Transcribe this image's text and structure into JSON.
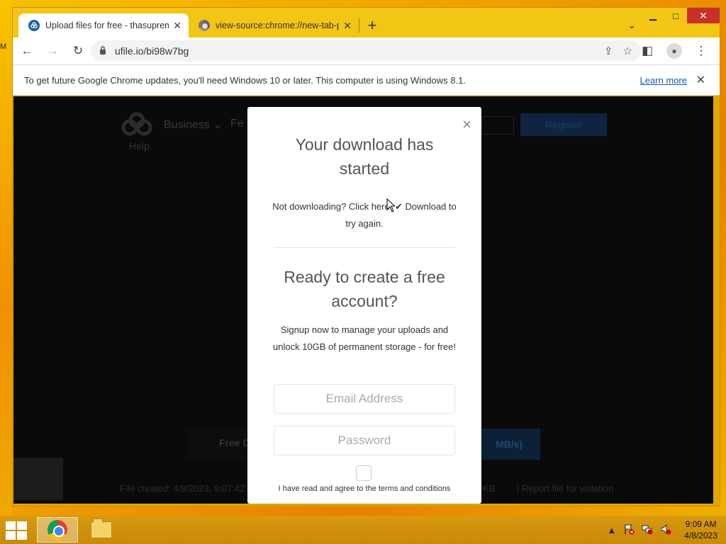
{
  "desktop": {
    "edge_label": "M"
  },
  "window": {
    "controls": {
      "minimize": "▁",
      "maximize": "□",
      "close": "✕"
    }
  },
  "tabs": [
    {
      "title": "Upload files for free - thasuprem",
      "favicon": "ufile-icon",
      "close": "✕",
      "active": true
    },
    {
      "title": "view-source:chrome://new-tab-p",
      "favicon": "chrome-icon",
      "close": "✕",
      "active": false
    }
  ],
  "new_tab": "+",
  "tab_search": "⌄",
  "toolbar": {
    "back": "←",
    "forward": "→",
    "reload": "↻",
    "url": "ufile.io/bi98w7bg",
    "share": "⇪",
    "star": "☆",
    "sidepanel": "◧",
    "profile": "●",
    "menu": "⋮"
  },
  "infobar": {
    "message": "To get future Google Chrome updates, you'll need Windows 10 or later. This computer is using Windows 8.1.",
    "learn_more": "Learn more",
    "close": "✕"
  },
  "background_page": {
    "help": "Help",
    "nav_business": "Business ⌄",
    "nav_fe": "Fe",
    "register": "Register",
    "free_left": "Free D",
    "free_right": "MB/s)",
    "file_created": "File created: 4/8/2023, 9:07:42",
    "file_size": "KB",
    "report": "|     Report file for violation"
  },
  "modal": {
    "close": "×",
    "heading_download": "Your download has started",
    "not_downloading": "Not downloading? Click here:",
    "download_link": "✔ Download to try again.",
    "heading_account": "Ready to create a free account?",
    "signup_text": "Signup now to manage your uploads and unlock 10GB of permanent storage - for free!",
    "email_placeholder": "Email Address",
    "password_placeholder": "Password",
    "terms": "I have read and agree to the terms and conditions"
  },
  "taskbar": {
    "tray_up": "▲",
    "clock_time": "9:09 AM",
    "clock_date": "4/8/2023"
  }
}
